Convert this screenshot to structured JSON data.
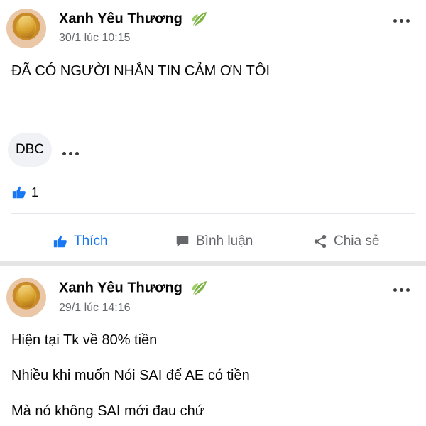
{
  "posts": [
    {
      "author": "Xanh Yêu Thương",
      "time": "30/1 lúc 10:15",
      "text": "ĐÃ CÓ NGƯỜI NHẮN TIN CẢM ƠN TÔI",
      "comment_chip": "DBC",
      "like_count": "1",
      "actions": {
        "like": "Thích",
        "comment": "Bình luận",
        "share": "Chia sẻ"
      }
    },
    {
      "author": "Xanh Yêu Thương",
      "time": "29/1 lúc 14:16",
      "lines": [
        "Hiện tại Tk về 80% tiền",
        "Nhiều khi muốn Nói SAI để AE có tiền",
        "Mà nó không SAI mới đau chứ"
      ]
    }
  ],
  "colors": {
    "accent": "#1877f2",
    "secondary_text": "#65676b",
    "leaf": "#7cb342"
  }
}
